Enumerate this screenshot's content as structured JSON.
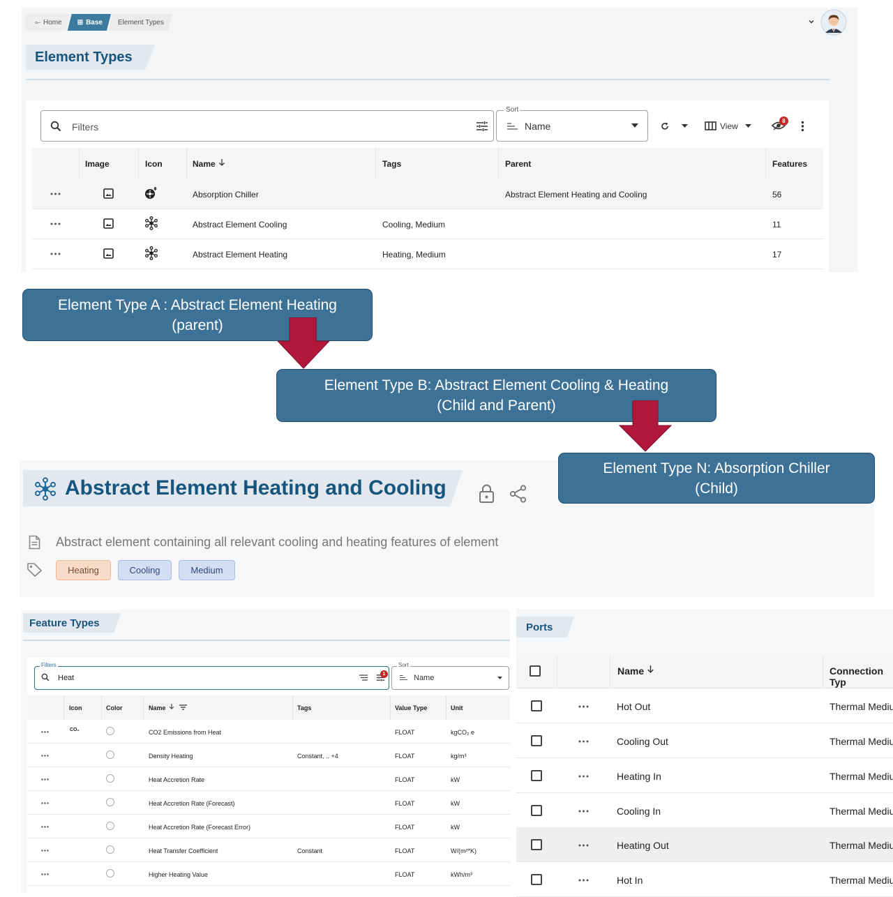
{
  "breadcrumb": {
    "home": "Home",
    "base": "Base",
    "current": "Element Types"
  },
  "element_types_page": {
    "title": "Element Types",
    "filter_placeholder": "Filters",
    "sort_label": "Sort",
    "sort_value": "Name",
    "view_label": "View",
    "hidden_badge": "8",
    "columns": {
      "image": "Image",
      "icon": "Icon",
      "name": "Name",
      "tags": "Tags",
      "parent": "Parent",
      "features": "Features"
    },
    "rows": [
      {
        "name": "Absorption Chiller",
        "tags": "",
        "parent": "Abstract Element Heating and Cooling",
        "features": "56",
        "icon": "chiller-icon"
      },
      {
        "name": "Abstract Element Cooling",
        "tags": "Cooling, Medium",
        "parent": "",
        "features": "11",
        "icon": "network-icon"
      },
      {
        "name": "Abstract Element Heating",
        "tags": "Heating, Medium",
        "parent": "",
        "features": "17",
        "icon": "network-icon"
      }
    ]
  },
  "callouts": {
    "a": {
      "line1": "Element Type A : Abstract Element Heating",
      "line2": "(parent)"
    },
    "b": {
      "line1": "Element Type B: Abstract Element Cooling & Heating",
      "line2": "(Child and Parent)"
    },
    "n": {
      "line1": "Element Type N: Absorption Chiller",
      "line2": "(Child)"
    }
  },
  "colors": {
    "callout_bg": "#3e7196",
    "arrow": "#b0173a",
    "brand": "#16557e"
  },
  "element_detail": {
    "title": "Abstract Element Heating and Cooling",
    "description": "Abstract element containing all relevant cooling and heating features of element",
    "tags": [
      "Heating",
      "Cooling",
      "Medium"
    ]
  },
  "feature_types": {
    "title": "Feature Types",
    "filter_label": "Filters",
    "filter_value": "Heat",
    "filter_badge": "1",
    "sort_label": "Sort",
    "sort_value": "Name",
    "columns": {
      "icon": "Icon",
      "color": "Color",
      "name": "Name",
      "tags": "Tags",
      "value_type": "Value Type",
      "unit": "Unit"
    },
    "rows": [
      {
        "icon_text": "CO₂",
        "name": "CO2 Emissions from Heat",
        "tags": "",
        "value_type": "FLOAT",
        "unit": "kgCO₂ e"
      },
      {
        "icon_text": "",
        "name": "Density Heating",
        "tags": "Constant, .. +4",
        "value_type": "FLOAT",
        "unit": "kg/m³"
      },
      {
        "icon_text": "",
        "name": "Heat Accretion Rate",
        "tags": "",
        "value_type": "FLOAT",
        "unit": "kW"
      },
      {
        "icon_text": "",
        "name": "Heat Accretion Rate (Forecast)",
        "tags": "",
        "value_type": "FLOAT",
        "unit": "kW"
      },
      {
        "icon_text": "",
        "name": "Heat Accretion Rate (Forecast Error)",
        "tags": "",
        "value_type": "FLOAT",
        "unit": "kW"
      },
      {
        "icon_text": "",
        "name": "Heat Transfer Coefficient",
        "tags": "Constant",
        "value_type": "FLOAT",
        "unit": "W/(m²*K)"
      },
      {
        "icon_text": "",
        "name": "Higher Heating Value",
        "tags": "",
        "value_type": "FLOAT",
        "unit": "kWh/m³"
      }
    ]
  },
  "ports": {
    "title": "Ports",
    "columns": {
      "name": "Name",
      "connection_type": "Connection Typ"
    },
    "rows": [
      {
        "name": "Hot Out",
        "connection_type": "Thermal Mediu"
      },
      {
        "name": "Cooling Out",
        "connection_type": "Thermal Mediu"
      },
      {
        "name": "Heating In",
        "connection_type": "Thermal Mediu"
      },
      {
        "name": "Cooling In",
        "connection_type": "Thermal Mediu"
      },
      {
        "name": "Heating Out",
        "connection_type": "Thermal Mediu"
      },
      {
        "name": "Hot In",
        "connection_type": "Thermal Mediu"
      }
    ]
  }
}
